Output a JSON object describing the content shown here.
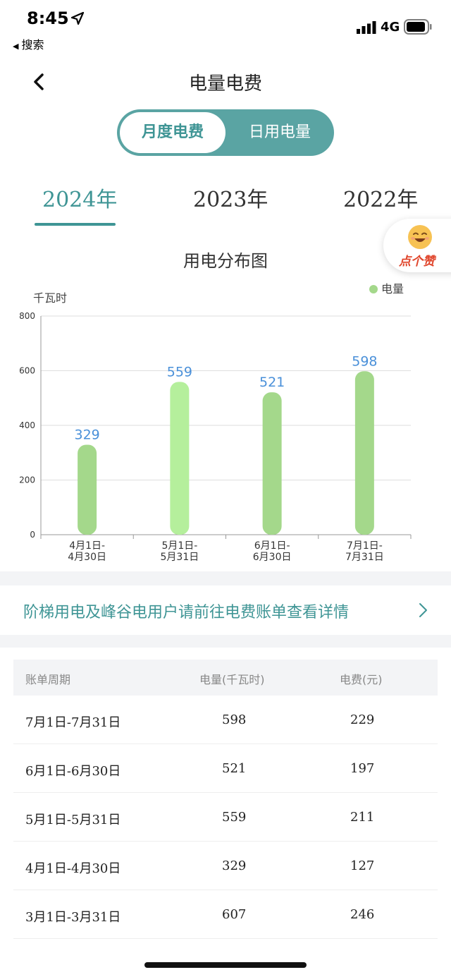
{
  "status_bar": {
    "time": "8:45",
    "back_app": "搜索",
    "network": "4G"
  },
  "header": {
    "title": "电量电费"
  },
  "segment": {
    "options": [
      "月度电费",
      "日用电量"
    ],
    "active": "月度电费"
  },
  "year_tabs": [
    "2024年",
    "2023年",
    "2022年"
  ],
  "active_year": "2024年",
  "like_badge": {
    "label": "点个赞"
  },
  "chart": {
    "title": "用电分布图",
    "unit": "千瓦时",
    "legend": "电量"
  },
  "chart_data": {
    "type": "bar",
    "title": "用电分布图",
    "ylabel": "千瓦时",
    "ylim": [
      0,
      800
    ],
    "yticks": [
      0,
      200,
      400,
      600,
      800
    ],
    "categories": [
      "4月1日-4月30日",
      "5月1日-5月31日",
      "6月1日-6月30日",
      "7月1日-7月31日"
    ],
    "category_lines": [
      [
        "4月1日-",
        "4月30日"
      ],
      [
        "5月1日-",
        "5月31日"
      ],
      [
        "6月1日-",
        "6月30日"
      ],
      [
        "7月1日-",
        "7月31日"
      ]
    ],
    "series": [
      {
        "name": "电量",
        "values": [
          329,
          559,
          521,
          598
        ]
      }
    ],
    "bar_colors": [
      "#a4d88b",
      "#b5ef9c",
      "#a4d88b",
      "#a4d88b"
    ],
    "value_label_color": "#4a90d9",
    "legend_position": "top-right",
    "grid": true
  },
  "notice": {
    "text": "阶梯用电及峰谷电用户请前往电费账单查看详情"
  },
  "table": {
    "headers": [
      "账单周期",
      "电量(千瓦时)",
      "电费(元)"
    ],
    "rows": [
      {
        "period": "7月1日-7月31日",
        "usage": "598",
        "fee": "229"
      },
      {
        "period": "6月1日-6月30日",
        "usage": "521",
        "fee": "197"
      },
      {
        "period": "5月1日-5月31日",
        "usage": "559",
        "fee": "211"
      },
      {
        "period": "4月1日-4月30日",
        "usage": "329",
        "fee": "127"
      },
      {
        "period": "3月1日-3月31日",
        "usage": "607",
        "fee": "246"
      }
    ]
  },
  "colors": {
    "accent": "#3f9595",
    "segment_bg": "#5aa4a3",
    "bar": "#a4d88b",
    "value_label": "#4a90d9"
  }
}
